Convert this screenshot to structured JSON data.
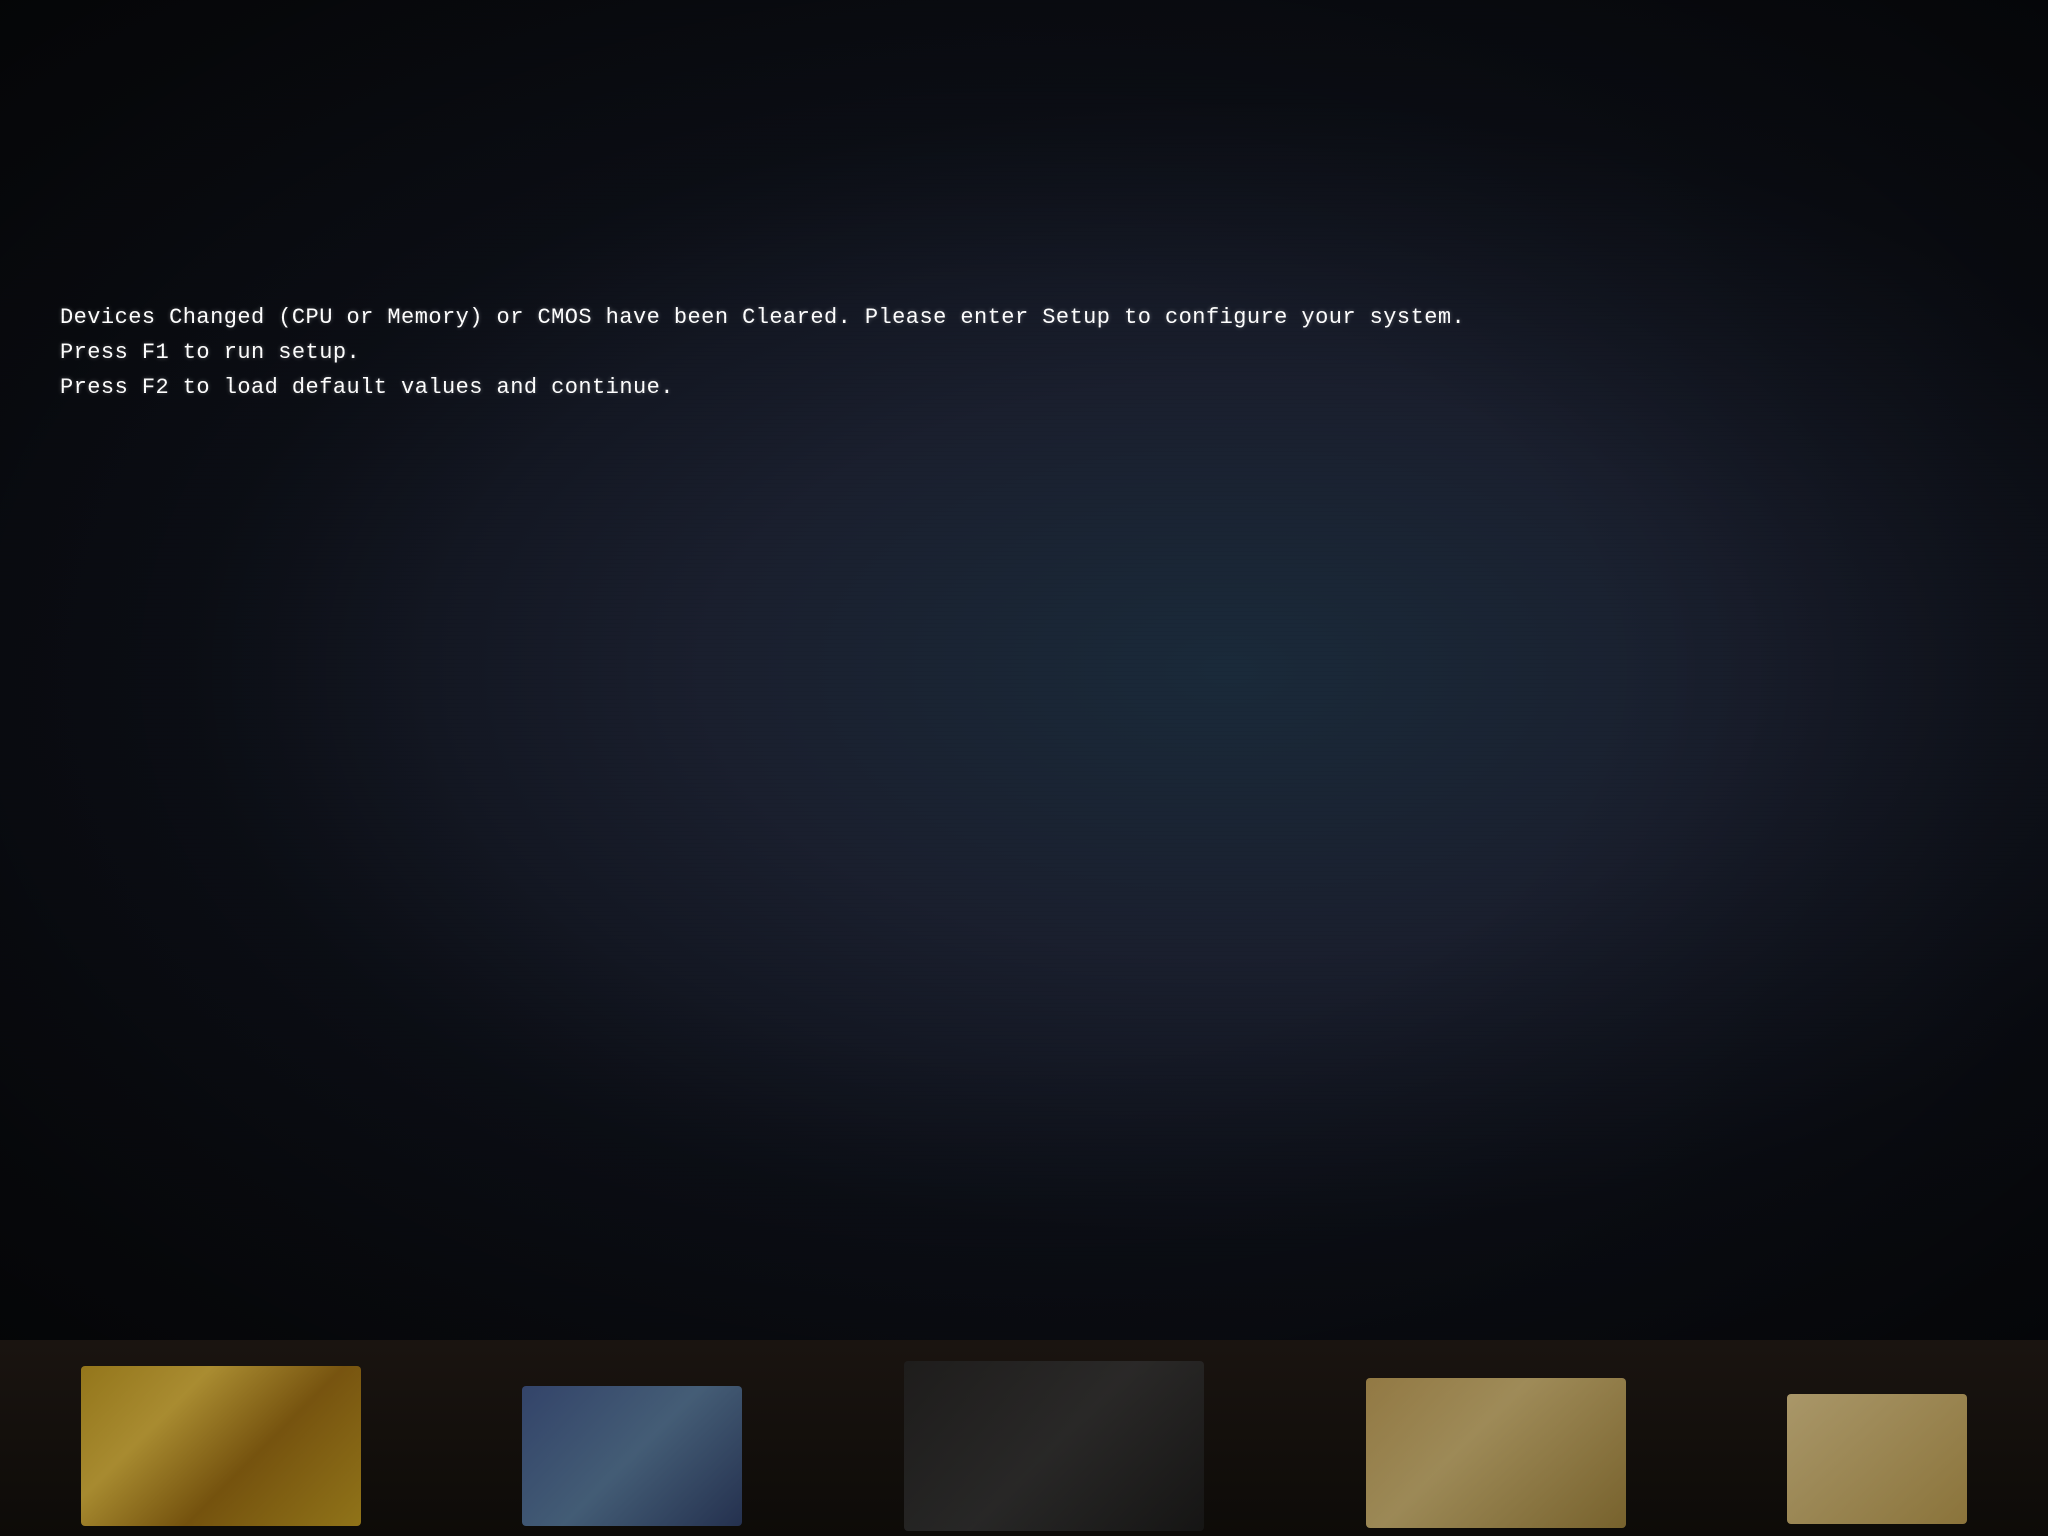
{
  "screen": {
    "background_color": "#0d1018",
    "type": "bios_error_screen"
  },
  "bios_message": {
    "line1": "Devices Changed (CPU or Memory) or CMOS have been Cleared. Please enter Setup to configure your system.",
    "line2": "Press F1 to run setup.",
    "line3": "Press F2 to load default values and continue."
  }
}
